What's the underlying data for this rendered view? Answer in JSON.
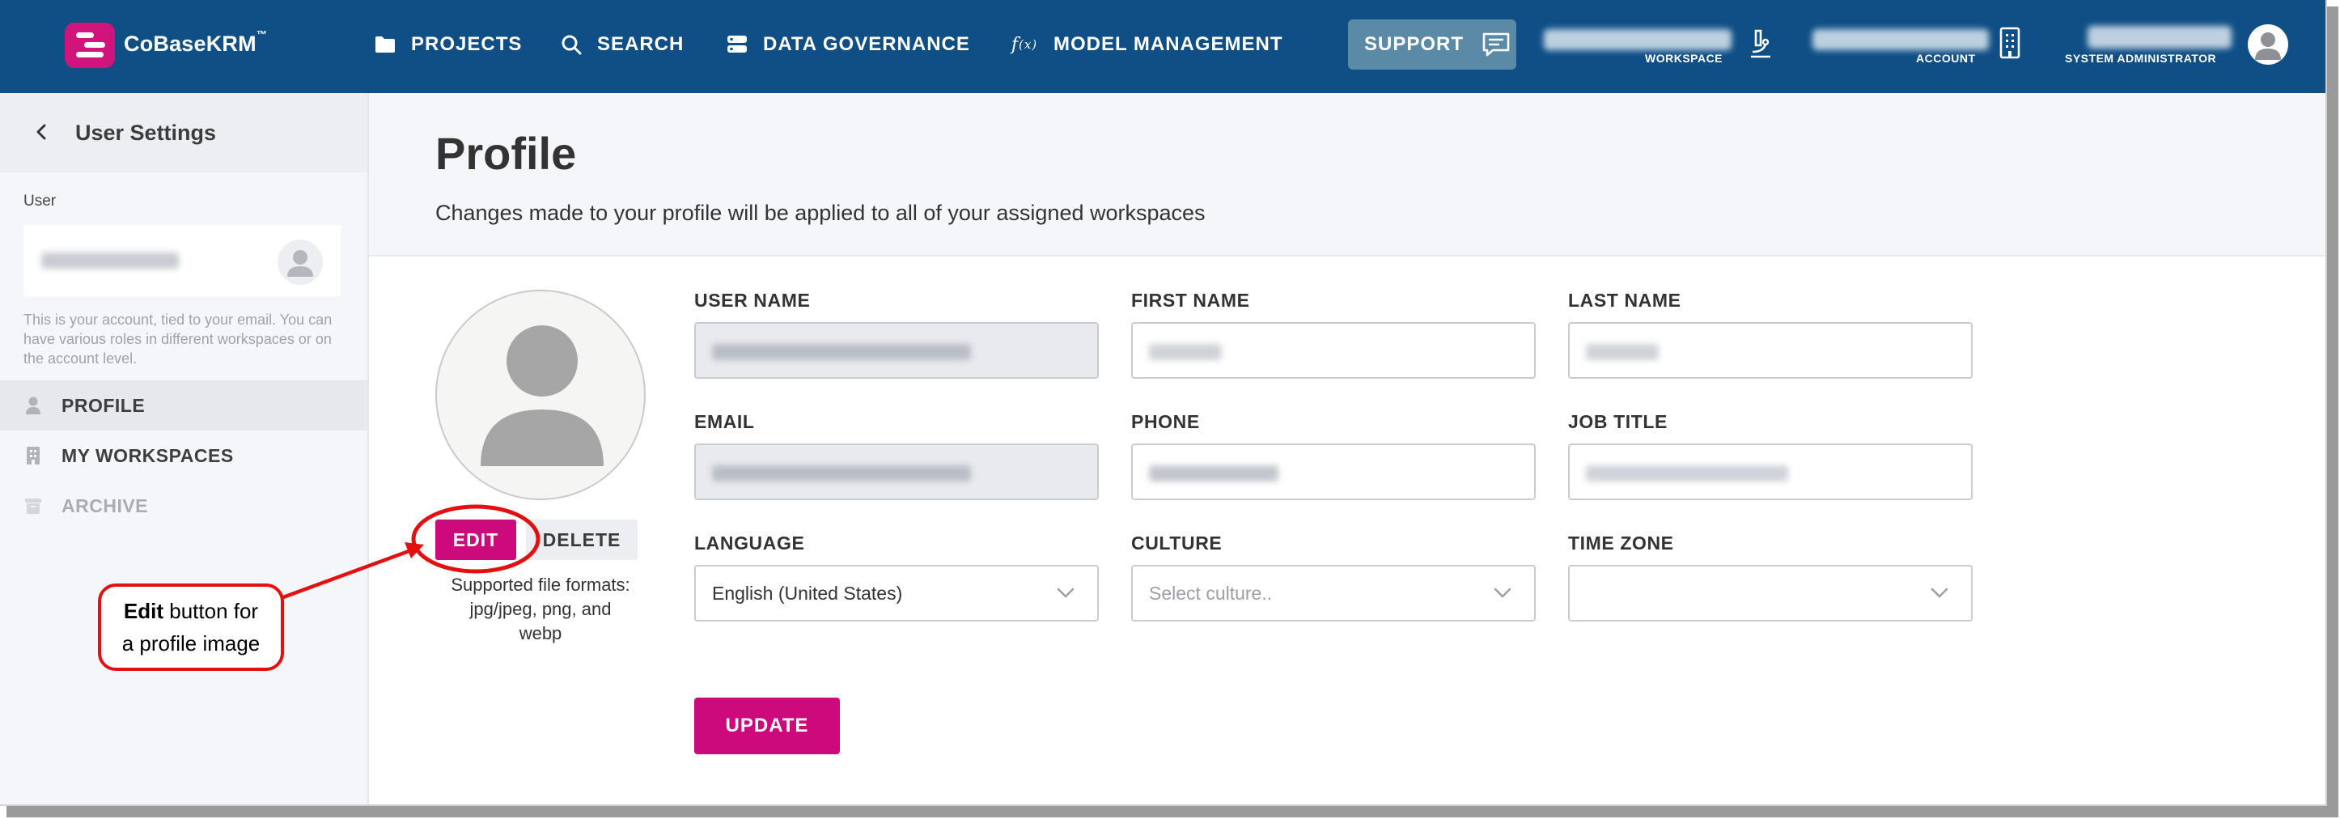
{
  "topbar": {
    "brand": "CoBaseKRM",
    "brand_tm": "™",
    "nav": [
      {
        "label": "PROJECTS",
        "icon": "folder-icon"
      },
      {
        "label": "SEARCH",
        "icon": "search-icon"
      },
      {
        "label": "DATA GOVERNANCE",
        "icon": "database-icon"
      },
      {
        "label": "MODEL MANAGEMENT",
        "icon": "function-icon"
      }
    ],
    "support_label": "SUPPORT",
    "workspace_caption": "WORKSPACE",
    "account_caption": "ACCOUNT",
    "role_caption": "SYSTEM ADMINISTRATOR",
    "brand_color": "#0f4f86",
    "accent_color": "#cc0a7c"
  },
  "sidebar": {
    "title": "User Settings",
    "user_label": "User",
    "note": "This is your account, tied to your email. You can have various roles in different workspaces or on the account level.",
    "items": [
      {
        "label": "PROFILE",
        "icon": "user-icon",
        "state": "active"
      },
      {
        "label": "MY WORKSPACES",
        "icon": "building-icon",
        "state": "normal"
      },
      {
        "label": "ARCHIVE",
        "icon": "archive-icon",
        "state": "disabled"
      }
    ]
  },
  "callout": {
    "bold": "Edit",
    "rest_line1": " button for",
    "line2": "a profile image"
  },
  "profile": {
    "title": "Profile",
    "subtitle": "Changes made to your profile will be applied to all of your assigned workspaces",
    "edit_label": "EDIT",
    "delete_label": "DELETE",
    "formats_line1": "Supported file formats:",
    "formats_line2": "jpg/jpeg, png, and",
    "formats_line3": "webp",
    "fields": {
      "username_label": "USER NAME",
      "firstname_label": "FIRST NAME",
      "lastname_label": "LAST NAME",
      "email_label": "EMAIL",
      "phone_label": "PHONE",
      "jobtitle_label": "JOB TITLE",
      "language_label": "LANGUAGE",
      "language_value": "English (United States)",
      "culture_label": "CULTURE",
      "culture_placeholder": "Select culture..",
      "timezone_label": "TIME ZONE",
      "timezone_value": ""
    },
    "update_label": "UPDATE"
  }
}
